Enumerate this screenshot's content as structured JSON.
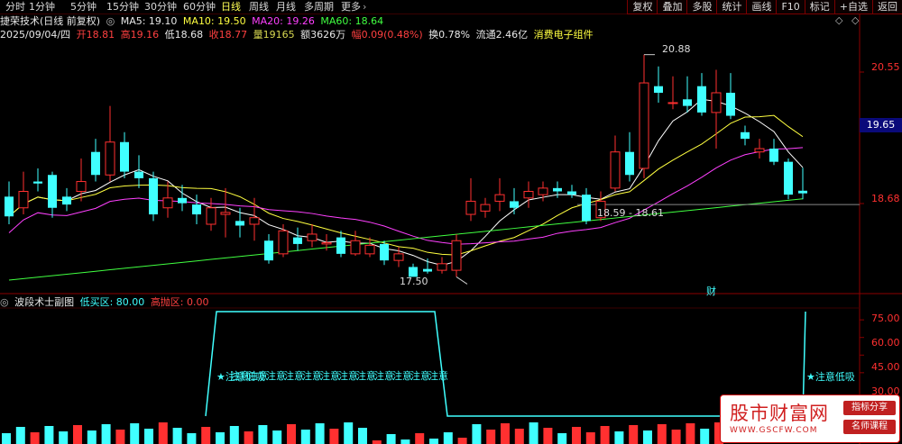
{
  "toolbar": {
    "tabs": [
      {
        "label": "分时"
      },
      {
        "label": "1分钟"
      },
      {
        "label": "5分钟"
      },
      {
        "label": "15分钟"
      },
      {
        "label": "30分钟"
      },
      {
        "label": "60分钟"
      },
      {
        "label": "日线"
      },
      {
        "label": "周线"
      },
      {
        "label": "月线"
      },
      {
        "label": "多周期"
      },
      {
        "label": "更多"
      }
    ],
    "active_tab": "日线",
    "buttons": [
      {
        "label": "复权"
      },
      {
        "label": "叠加"
      },
      {
        "label": "多股"
      },
      {
        "label": "统计"
      },
      {
        "label": "画线"
      },
      {
        "label": "F10"
      },
      {
        "label": "标记"
      },
      {
        "label": "+自选"
      },
      {
        "label": "返回"
      }
    ]
  },
  "header": {
    "title": "捷荣技术(日线 前复权)",
    "ma5": "MA5: 19.10",
    "ma10": "MA10: 19.50",
    "ma20": "MA20: 19.26",
    "ma60": "MA60: 18.64"
  },
  "quote": {
    "date": "2025/09/04/四",
    "open_label": "开",
    "open": "18.81",
    "high_label": "高",
    "high": "19.16",
    "low_label": "低",
    "low": "18.68",
    "close_label": "收",
    "close": "18.77",
    "volume_label": "量",
    "volume": "19165",
    "amount_label": "额",
    "amount": "3626万",
    "change_label": "幅",
    "change": "0.09(0.48%)",
    "turnover_label": "换",
    "turnover": "0.78%",
    "float_label": "流通",
    "float": "2.46亿",
    "concept": "消费电子组件"
  },
  "price_axis": {
    "ticks": [
      "20.55",
      "18.68"
    ],
    "current": "19.65"
  },
  "annotations": {
    "high_mark": "20.88",
    "low_mark": "17.50",
    "range": "18.59 - 18.61",
    "cai": "财"
  },
  "indicator": {
    "title": "波段术士副图",
    "buy_label": "低买区: 80.00",
    "sell_label": "高抛区: 0.00",
    "ticks": [
      "75.00",
      "60.00",
      "45.00",
      "30.00"
    ],
    "signal_left": "★注意低吸",
    "signal_right": "★注意低吸"
  },
  "watermark": {
    "site": "股市财富网",
    "url": "WWW.GSCFW.COM",
    "tag1": "指标分享",
    "tag2": "名师课程"
  },
  "colors": {
    "up": "#ff3030",
    "down": "#40ffff",
    "ma5": "#ffffff",
    "ma10": "#ffff40",
    "ma20": "#ff40ff",
    "ma60": "#40ff40",
    "axis": "#8b0000"
  },
  "chart_data": {
    "type": "candlestick",
    "ylim": [
      17.3,
      21.3
    ],
    "candles": [
      [
        18.72,
        18.42,
        18.95,
        18.3
      ],
      [
        18.55,
        18.8,
        19.1,
        18.45
      ],
      [
        18.95,
        18.92,
        19.15,
        18.8
      ],
      [
        19.05,
        18.55,
        19.1,
        18.4
      ],
      [
        18.72,
        18.6,
        18.85,
        18.5
      ],
      [
        18.8,
        18.95,
        19.3,
        18.65
      ],
      [
        19.4,
        19.05,
        19.6,
        18.95
      ],
      [
        19.05,
        19.55,
        20.1,
        18.95
      ],
      [
        19.55,
        19.1,
        19.7,
        19.0
      ],
      [
        19.1,
        19.0,
        19.35,
        18.85
      ],
      [
        19.0,
        18.45,
        19.1,
        18.35
      ],
      [
        18.55,
        18.7,
        18.95,
        18.4
      ],
      [
        18.7,
        18.62,
        18.9,
        18.5
      ],
      [
        18.6,
        18.45,
        18.75,
        18.3
      ],
      [
        18.3,
        18.55,
        18.7,
        18.2
      ],
      [
        18.45,
        18.48,
        18.85,
        18.1
      ],
      [
        18.35,
        18.28,
        18.55,
        18.1
      ],
      [
        18.3,
        18.4,
        18.7,
        18.05
      ],
      [
        18.05,
        17.75,
        18.15,
        17.7
      ],
      [
        17.85,
        18.2,
        18.3,
        17.8
      ],
      [
        18.1,
        18.0,
        18.25,
        17.9
      ],
      [
        18.05,
        18.15,
        18.3,
        17.95
      ],
      [
        18.0,
        18.02,
        18.15,
        17.9
      ],
      [
        18.1,
        17.85,
        18.2,
        17.8
      ],
      [
        17.85,
        18.05,
        18.2,
        17.82
      ],
      [
        17.85,
        17.98,
        18.1,
        17.8
      ],
      [
        18.0,
        17.75,
        18.05,
        17.68
      ],
      [
        17.75,
        17.85,
        17.95,
        17.65
      ],
      [
        17.65,
        17.5,
        17.7,
        17.55
      ],
      [
        17.62,
        17.58,
        17.78,
        17.55
      ],
      [
        17.6,
        17.7,
        17.8,
        17.55
      ],
      [
        17.6,
        18.05,
        18.15,
        17.5
      ],
      [
        18.45,
        18.65,
        19.0,
        18.35
      ],
      [
        18.5,
        18.6,
        18.7,
        18.4
      ],
      [
        18.65,
        18.75,
        19.0,
        18.5
      ],
      [
        18.65,
        18.55,
        18.85,
        18.45
      ],
      [
        18.7,
        18.8,
        18.95,
        18.55
      ],
      [
        18.75,
        18.85,
        18.95,
        18.65
      ],
      [
        18.85,
        18.8,
        18.95,
        18.7
      ],
      [
        18.8,
        18.75,
        18.9,
        18.7
      ],
      [
        18.75,
        18.35,
        18.85,
        18.3
      ],
      [
        18.4,
        18.65,
        18.8,
        18.35
      ],
      [
        18.85,
        19.4,
        19.65,
        18.8
      ],
      [
        19.4,
        19.05,
        19.7,
        18.95
      ],
      [
        19.15,
        20.45,
        20.88,
        19.0
      ],
      [
        20.4,
        20.3,
        20.7,
        20.15
      ],
      [
        20.15,
        20.15,
        20.55,
        20.05
      ],
      [
        20.2,
        20.1,
        20.55,
        20.0
      ],
      [
        20.4,
        20.0,
        20.6,
        19.95
      ],
      [
        20.0,
        20.3,
        20.65,
        19.45
      ],
      [
        20.3,
        19.95,
        20.6,
        19.9
      ],
      [
        19.7,
        19.6,
        19.8,
        19.5
      ],
      [
        19.4,
        19.45,
        19.6,
        19.3
      ],
      [
        19.45,
        19.25,
        19.6,
        19.2
      ],
      [
        19.25,
        18.75,
        19.3,
        18.68
      ],
      [
        18.81,
        18.77,
        19.16,
        18.68
      ]
    ],
    "indicator_levels": [
      75.0,
      60.0,
      45.0,
      30.0
    ]
  }
}
